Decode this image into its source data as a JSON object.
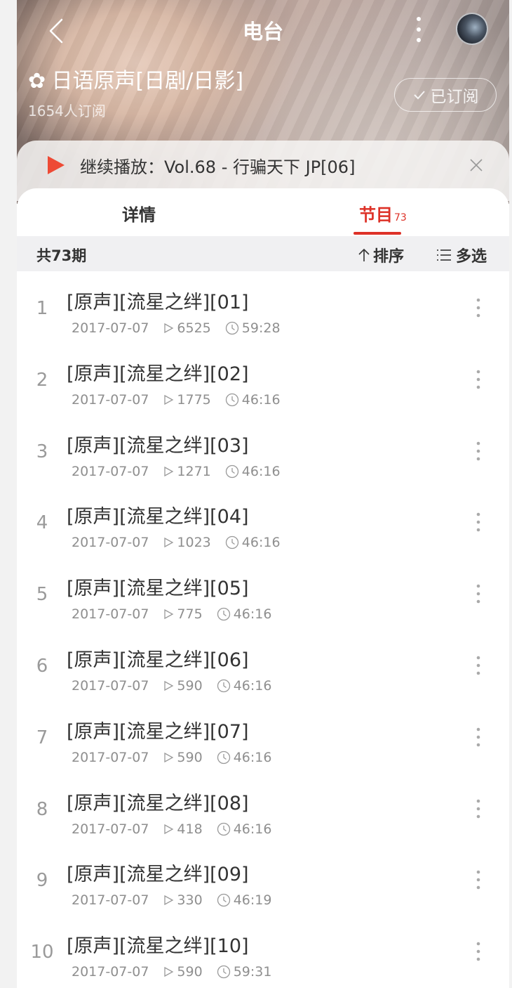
{
  "header": {
    "title": "电台",
    "back_icon": "chevron-left-icon",
    "more_icon": "more-vertical-icon"
  },
  "radio": {
    "flower": "✿",
    "name": "日语原声[日剧/日影]",
    "subscribers": "1654人订阅",
    "subscribe_button": "已订阅"
  },
  "continue_play": {
    "text": "继续播放：Vol.68 - 行骗天下 JP[06]"
  },
  "tabs": [
    {
      "label": "详情"
    },
    {
      "label": "节目",
      "count": "73"
    }
  ],
  "toolbar": {
    "total": "共73期",
    "sort": "排序",
    "multi_select": "多选"
  },
  "episodes": [
    {
      "index": "1",
      "title": "[原声][流星之绊][01]",
      "date": "2017-07-07",
      "plays": "6525",
      "duration": "59:28"
    },
    {
      "index": "2",
      "title": "[原声][流星之绊][02]",
      "date": "2017-07-07",
      "plays": "1775",
      "duration": "46:16"
    },
    {
      "index": "3",
      "title": "[原声][流星之绊][03]",
      "date": "2017-07-07",
      "plays": "1271",
      "duration": "46:16"
    },
    {
      "index": "4",
      "title": "[原声][流星之绊][04]",
      "date": "2017-07-07",
      "plays": "1023",
      "duration": "46:16"
    },
    {
      "index": "5",
      "title": "[原声][流星之绊][05]",
      "date": "2017-07-07",
      "plays": "775",
      "duration": "46:16"
    },
    {
      "index": "6",
      "title": "[原声][流星之绊][06]",
      "date": "2017-07-07",
      "plays": "590",
      "duration": "46:16"
    },
    {
      "index": "7",
      "title": "[原声][流星之绊][07]",
      "date": "2017-07-07",
      "plays": "590",
      "duration": "46:16"
    },
    {
      "index": "8",
      "title": "[原声][流星之绊][08]",
      "date": "2017-07-07",
      "plays": "418",
      "duration": "46:16"
    },
    {
      "index": "9",
      "title": "[原声][流星之绊][09]",
      "date": "2017-07-07",
      "plays": "330",
      "duration": "46:19"
    },
    {
      "index": "10",
      "title": "[原声][流星之绊][10]",
      "date": "2017-07-07",
      "plays": "590",
      "duration": "59:31"
    }
  ],
  "colors": {
    "accent": "#dd3127",
    "text": "#333333",
    "muted": "#8f8f8f"
  }
}
